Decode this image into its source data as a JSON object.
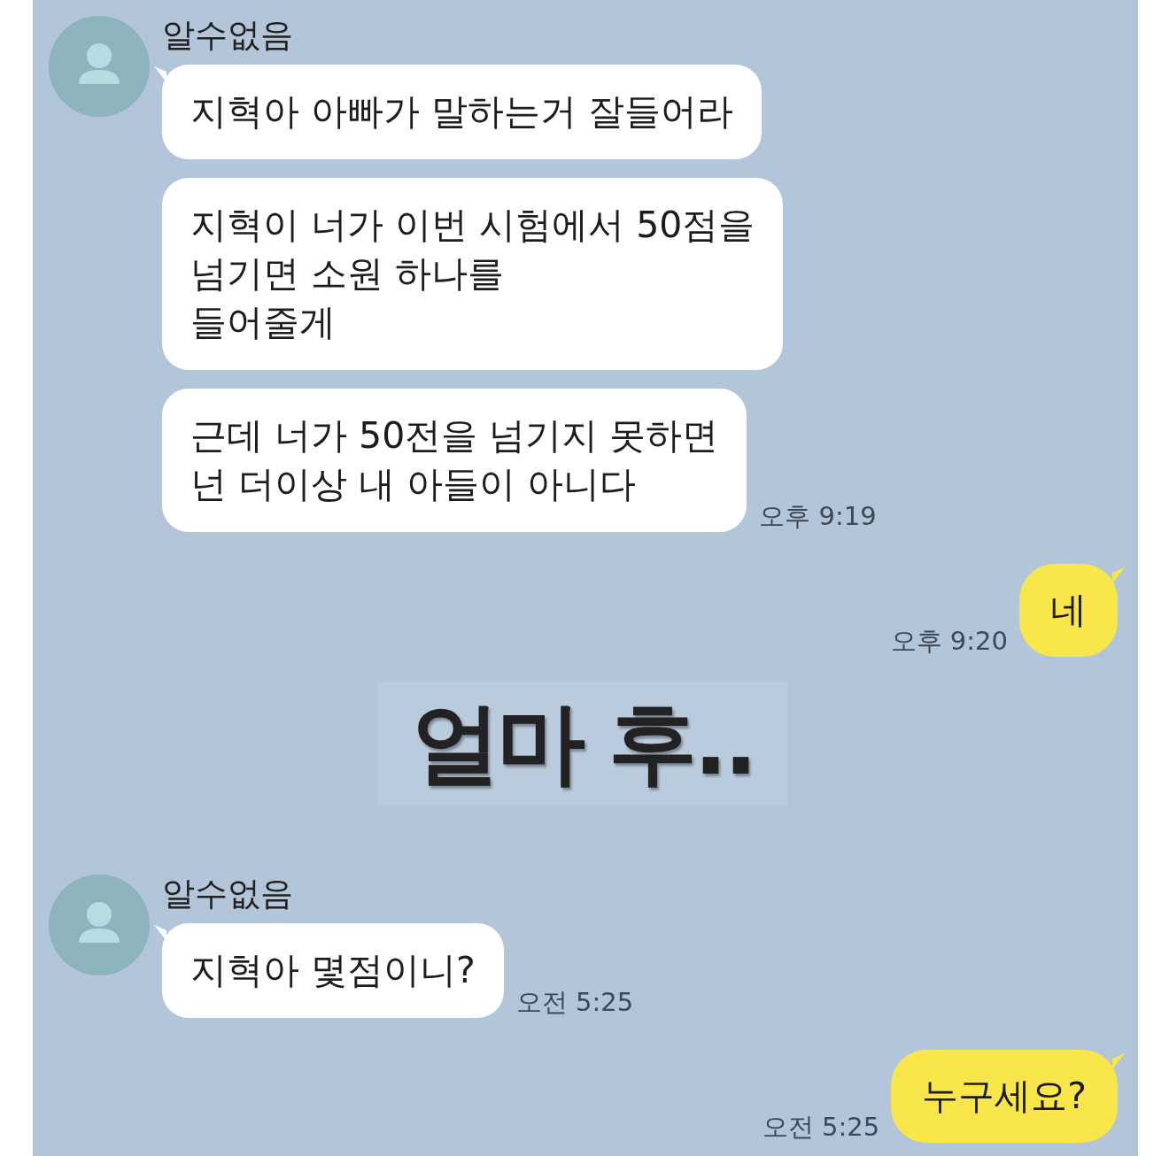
{
  "messages": [
    {
      "kind": "received",
      "sender": "알수없음",
      "bubbles": [
        {
          "text": "지혁아 아빠가 말하는거 잘들어라"
        },
        {
          "text": "지혁이 너가 이번 시험에서 50점을\n넘기면 소원 하나를\n들어줄게"
        },
        {
          "text": "근데 너가 50전을 넘기지 못하면\n넌 더이상 내 아들이 아니다"
        }
      ],
      "time": "오후 9:19"
    },
    {
      "kind": "sent",
      "bubbles": [
        {
          "text": "네"
        }
      ],
      "time": "오후 9:20"
    },
    {
      "kind": "caption",
      "text": "얼마 후.."
    },
    {
      "kind": "received",
      "sender": "알수없음",
      "bubbles": [
        {
          "text": "지혁아 몇점이니?"
        }
      ],
      "time": "오전 5:25"
    },
    {
      "kind": "sent",
      "bubbles": [
        {
          "text": "누구세요?"
        }
      ],
      "time": "오전 5:25"
    }
  ]
}
